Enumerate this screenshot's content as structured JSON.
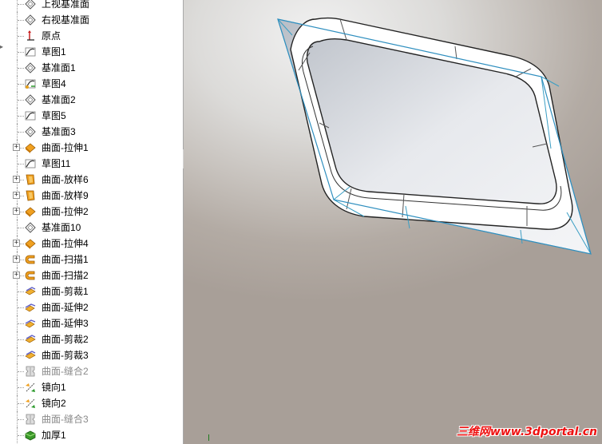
{
  "feature_tree": {
    "items": [
      {
        "label": "上视基准面",
        "icon": "plane-icon",
        "expandable": false,
        "suppressed": false
      },
      {
        "label": "右视基准面",
        "icon": "plane-icon",
        "expandable": false,
        "suppressed": false
      },
      {
        "label": "原点",
        "icon": "origin-icon",
        "expandable": false,
        "suppressed": false
      },
      {
        "label": "草图1",
        "icon": "sketch-icon",
        "expandable": false,
        "suppressed": false
      },
      {
        "label": "基准面1",
        "icon": "plane-icon",
        "expandable": false,
        "suppressed": false
      },
      {
        "label": "草图4",
        "icon": "3d-sketch-icon",
        "expandable": false,
        "suppressed": false
      },
      {
        "label": "基准面2",
        "icon": "plane-icon",
        "expandable": false,
        "suppressed": false
      },
      {
        "label": "草图5",
        "icon": "sketch-icon",
        "expandable": false,
        "suppressed": false
      },
      {
        "label": "基准面3",
        "icon": "plane-icon",
        "expandable": false,
        "suppressed": false
      },
      {
        "label": "曲面-拉伸1",
        "icon": "surface-extrude-icon",
        "expandable": true,
        "suppressed": false
      },
      {
        "label": "草图11",
        "icon": "sketch-icon",
        "expandable": false,
        "suppressed": false
      },
      {
        "label": "曲面-放样6",
        "icon": "surface-loft-icon",
        "expandable": true,
        "suppressed": false
      },
      {
        "label": "曲面-放样9",
        "icon": "surface-loft-icon",
        "expandable": true,
        "suppressed": false
      },
      {
        "label": "曲面-拉伸2",
        "icon": "surface-extrude-icon",
        "expandable": true,
        "suppressed": false
      },
      {
        "label": "基准面10",
        "icon": "plane-icon",
        "expandable": false,
        "suppressed": false
      },
      {
        "label": "曲面-拉伸4",
        "icon": "surface-extrude-icon",
        "expandable": true,
        "suppressed": false
      },
      {
        "label": "曲面-扫描1",
        "icon": "surface-sweep-icon",
        "expandable": true,
        "suppressed": false
      },
      {
        "label": "曲面-扫描2",
        "icon": "surface-sweep-icon",
        "expandable": true,
        "suppressed": false
      },
      {
        "label": "曲面-剪裁1",
        "icon": "surface-trim-icon",
        "expandable": false,
        "suppressed": false
      },
      {
        "label": "曲面-延伸2",
        "icon": "surface-extend-icon",
        "expandable": false,
        "suppressed": false
      },
      {
        "label": "曲面-延伸3",
        "icon": "surface-extend-icon",
        "expandable": false,
        "suppressed": false
      },
      {
        "label": "曲面-剪裁2",
        "icon": "surface-trim-icon",
        "expandable": false,
        "suppressed": false
      },
      {
        "label": "曲面-剪裁3",
        "icon": "surface-trim-icon",
        "expandable": false,
        "suppressed": false
      },
      {
        "label": "曲面-缝合2",
        "icon": "surface-knit-icon",
        "expandable": false,
        "suppressed": true
      },
      {
        "label": "镜向1",
        "icon": "mirror-icon",
        "expandable": false,
        "suppressed": false
      },
      {
        "label": "镜向2",
        "icon": "mirror-icon",
        "expandable": false,
        "suppressed": false
      },
      {
        "label": "曲面-缝合3",
        "icon": "surface-knit-icon",
        "expandable": false,
        "suppressed": true
      },
      {
        "label": "加厚1",
        "icon": "thicken-icon",
        "expandable": false,
        "suppressed": false
      }
    ]
  },
  "watermark": {
    "text": "三维网www.3dportal.cn"
  },
  "colors": {
    "edge_highlight": "#3a9ec4",
    "surface_white": "#ffffff",
    "suppressed_text": "#8a8a8a",
    "watermark": "#ee1111"
  }
}
